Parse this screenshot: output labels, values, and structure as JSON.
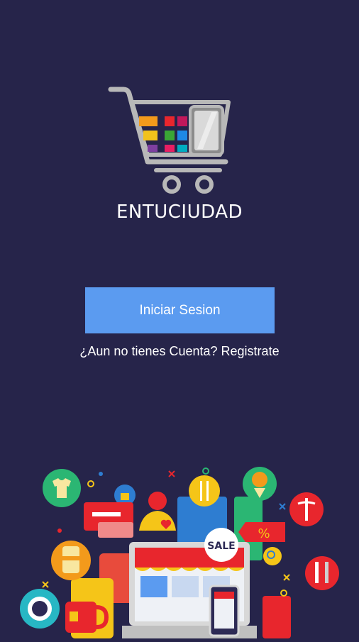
{
  "app": {
    "brand_name": "ENTUCIUDAD",
    "logo_icon": "shopping-cart-icon"
  },
  "actions": {
    "login_label": "Iniciar Sesion",
    "register_label": "¿Aun no tienes Cuenta? Registrate"
  },
  "illustration": {
    "sale_tag": "SALE",
    "discount_symbol": "%",
    "icons": [
      "tshirt-icon",
      "like-icon",
      "credit-card-icon",
      "user-icon",
      "cutlery-icon",
      "flowers-icon",
      "shopping-bag-icon",
      "percent-tag-icon",
      "medical-icon",
      "tools-icon",
      "laptop-store-icon",
      "smartphone-icon",
      "tea-cup-icon",
      "jar-icon",
      "dinner-plate-icon",
      "search-icon"
    ]
  },
  "colors": {
    "background": "#26244a",
    "button": "#5b9bf0",
    "text": "#ffffff"
  }
}
